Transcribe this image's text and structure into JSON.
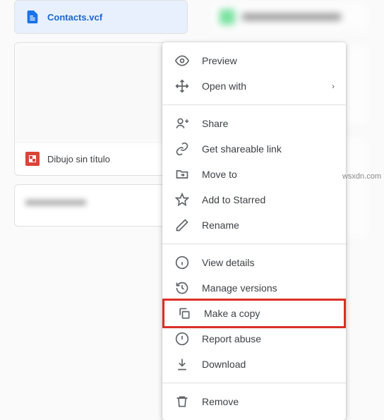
{
  "files": {
    "contacts": {
      "label": "Contacts.vcf"
    },
    "drawing": {
      "label": "Dibujo sin título"
    }
  },
  "menu": {
    "preview": "Preview",
    "open_with": "Open with",
    "share": "Share",
    "shareable_link": "Get shareable link",
    "move_to": "Move to",
    "add_starred": "Add to Starred",
    "rename": "Rename",
    "view_details": "View details",
    "manage_versions": "Manage versions",
    "make_copy": "Make a copy",
    "report_abuse": "Report abuse",
    "download": "Download",
    "remove": "Remove"
  },
  "watermark": "wsxdn.com"
}
